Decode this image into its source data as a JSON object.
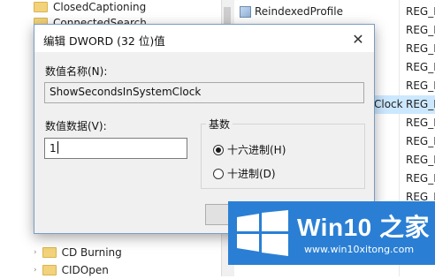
{
  "tree": {
    "items": [
      {
        "label": "ClosedCaptioning"
      },
      {
        "label": "ConnectedSearch"
      },
      {
        "label": "CD Burning"
      },
      {
        "label": "CIDOpen"
      }
    ]
  },
  "values_list": {
    "rows": [
      {
        "name": "ReindexedProfile",
        "type": "REG_D"
      },
      {
        "name": "",
        "type": "REG_D"
      },
      {
        "name": "",
        "type": "REG_D"
      },
      {
        "name": "",
        "type": "REG_D"
      },
      {
        "name": "",
        "type": "REG_D"
      },
      {
        "name": "Clock",
        "type": "REG_D",
        "selected": true
      },
      {
        "name": "",
        "type": "REG_D"
      },
      {
        "name": "",
        "type": "REG_D"
      },
      {
        "name": "",
        "type": "REG_D"
      },
      {
        "name": "",
        "type": "REG_D"
      },
      {
        "name": "",
        "type": "REG_D"
      },
      {
        "name": "",
        "type": "REG_D"
      },
      {
        "name": "",
        "type": "REG_D"
      },
      {
        "name": "",
        "type": "REG_D"
      }
    ]
  },
  "dialog": {
    "title": "编辑 DWORD (32 位)值",
    "value_name_label": "数值名称(N):",
    "value_name": "ShowSecondsInSystemClock",
    "value_data_label": "数值数据(V):",
    "value_data": "1",
    "base_label": "基数",
    "base_options": [
      {
        "label": "十六进制(H)",
        "checked": true
      },
      {
        "label": "十进制(D)",
        "checked": false
      }
    ]
  },
  "watermark": {
    "brand": "Win10 之家",
    "url": "www.win10xitong.com",
    "color": "#2a7fd4"
  }
}
